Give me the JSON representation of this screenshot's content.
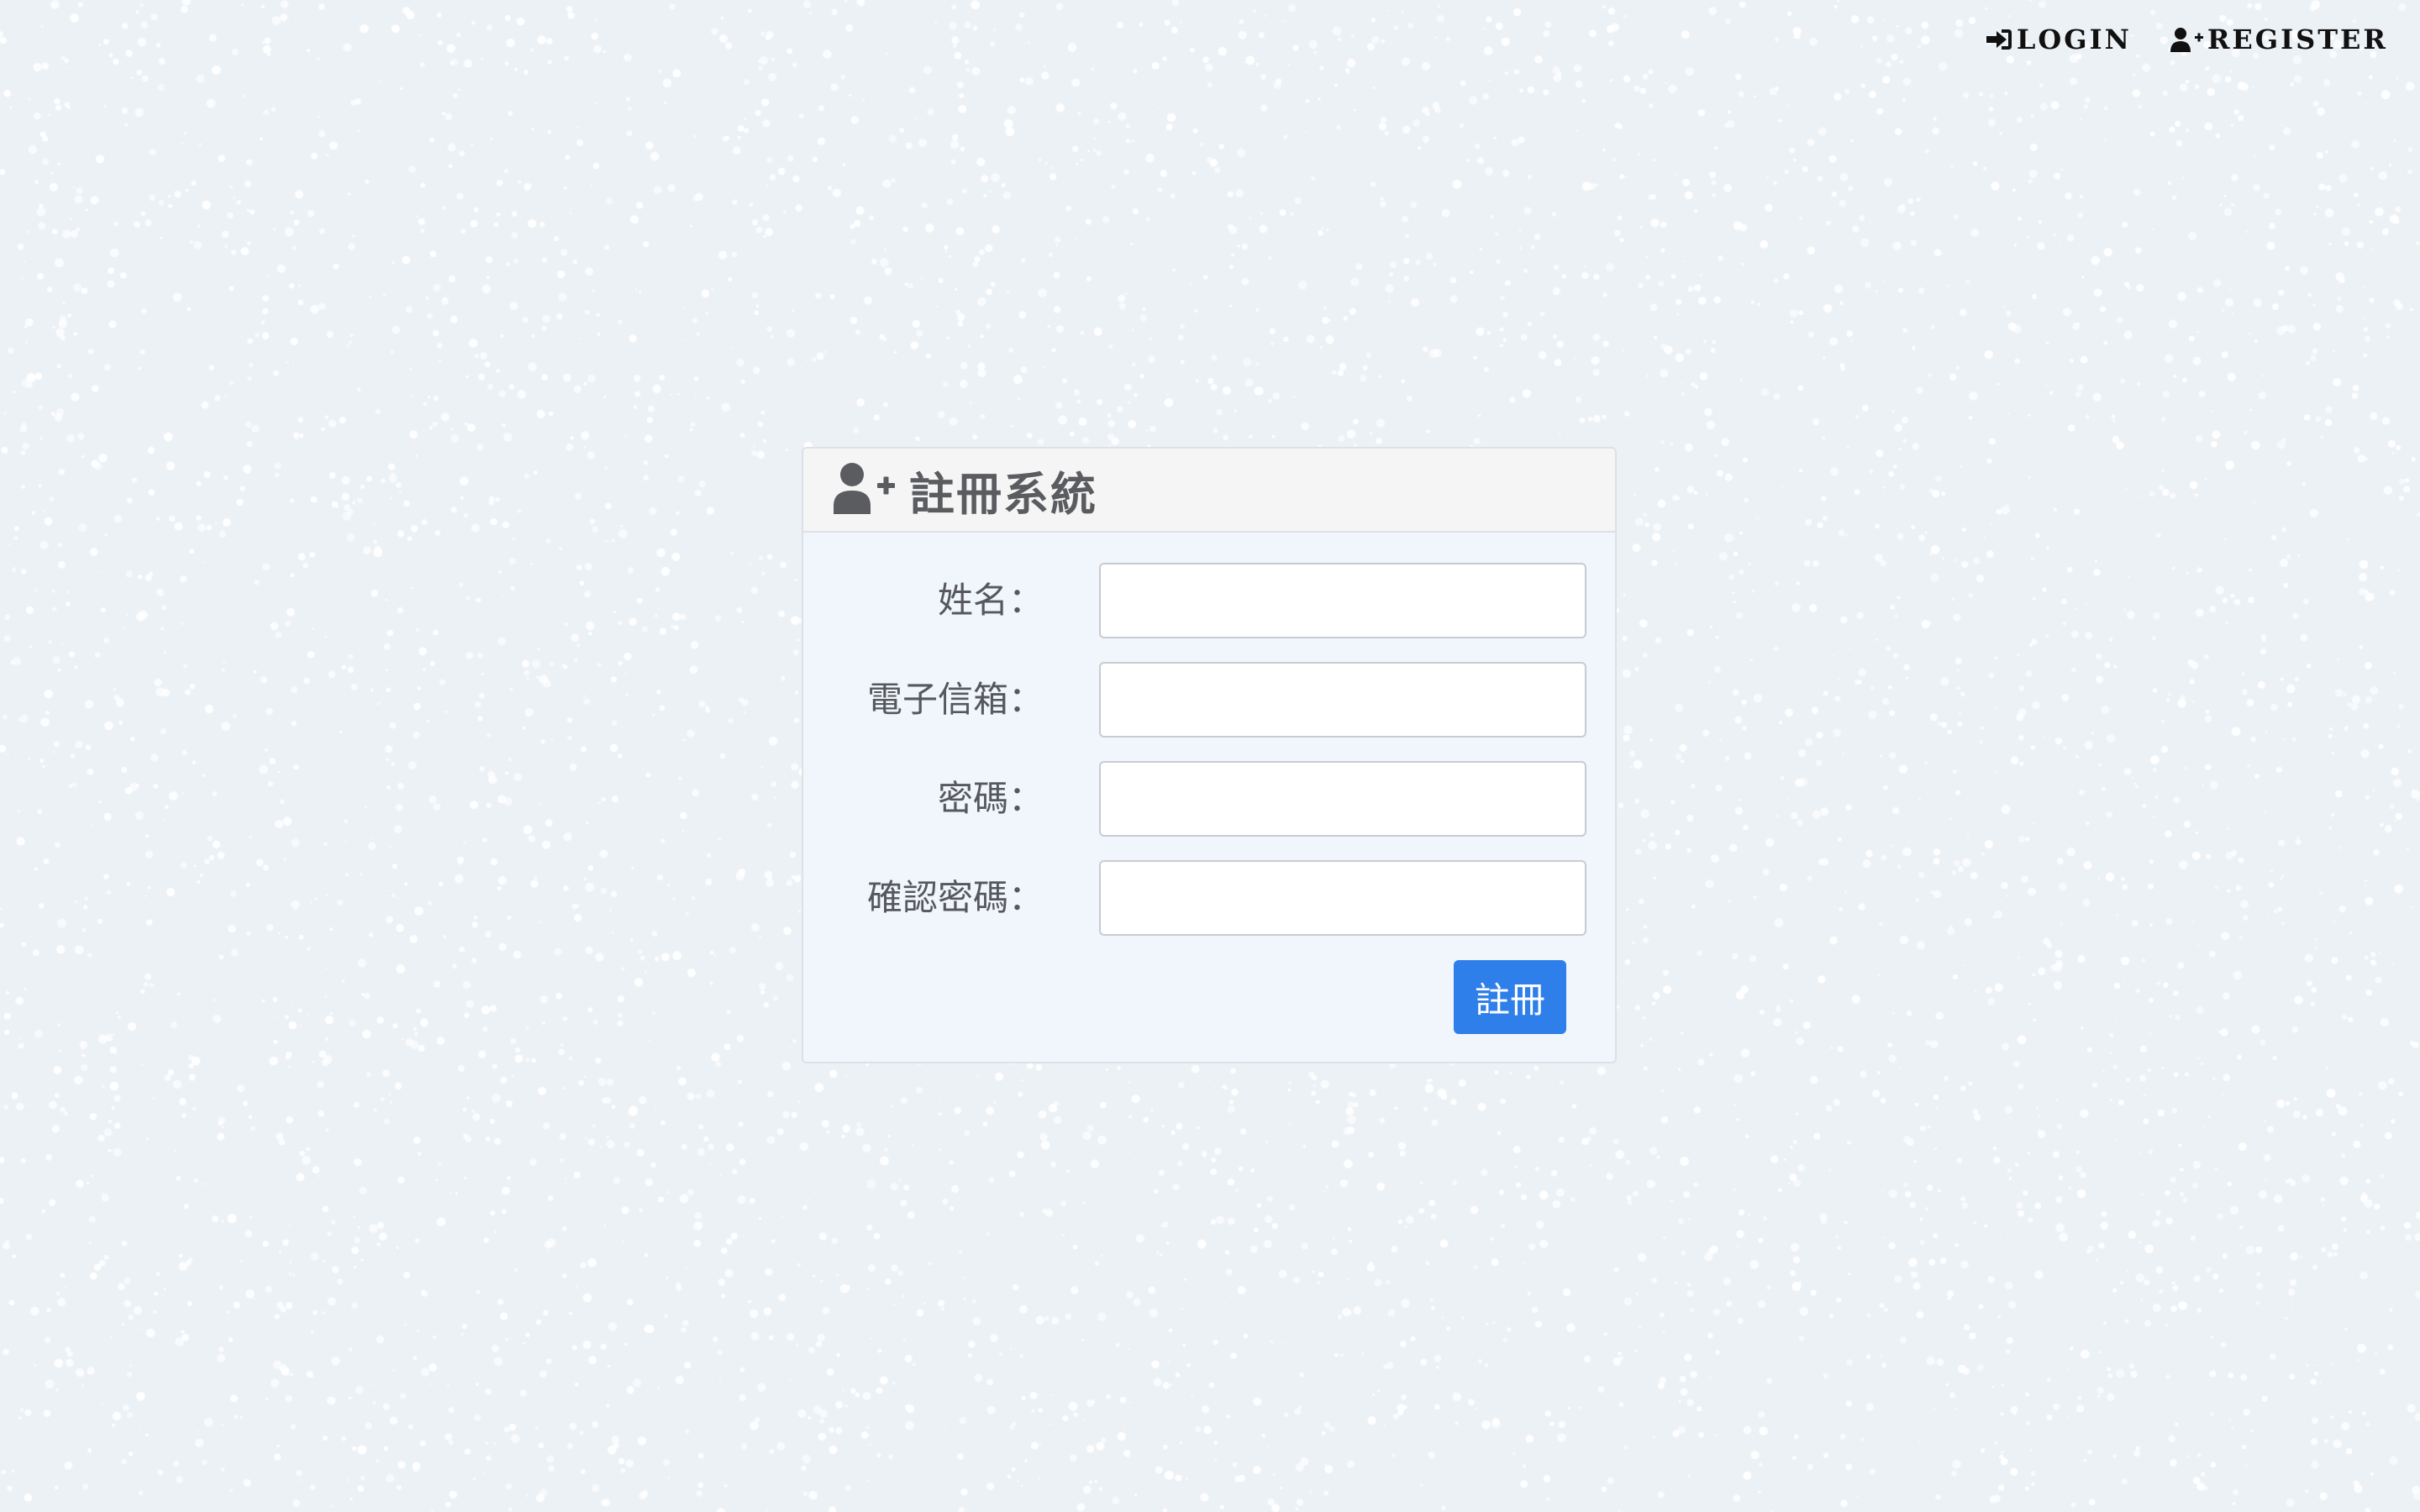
{
  "nav": {
    "login_label": "LOGIN",
    "register_label": "REGISTER",
    "login_icon": "sign-in-icon",
    "register_icon": "user-plus-icon"
  },
  "form": {
    "title": "註冊系統",
    "title_icon": "user-plus-icon",
    "fields": [
      {
        "label": "姓名：",
        "value": "",
        "placeholder": ""
      },
      {
        "label": "電子信箱：",
        "value": "",
        "placeholder": ""
      },
      {
        "label": "密碼：",
        "value": "",
        "placeholder": ""
      },
      {
        "label": "確認密碼：",
        "value": "",
        "placeholder": ""
      }
    ],
    "submit_label": "註冊"
  },
  "colors": {
    "background": "#ecf1f6",
    "panel_body": "#f1f6fc",
    "panel_header": "#f5f5f5",
    "button": "#2f7fea",
    "title_text": "#5a5c60",
    "nav_text": "#111111"
  }
}
